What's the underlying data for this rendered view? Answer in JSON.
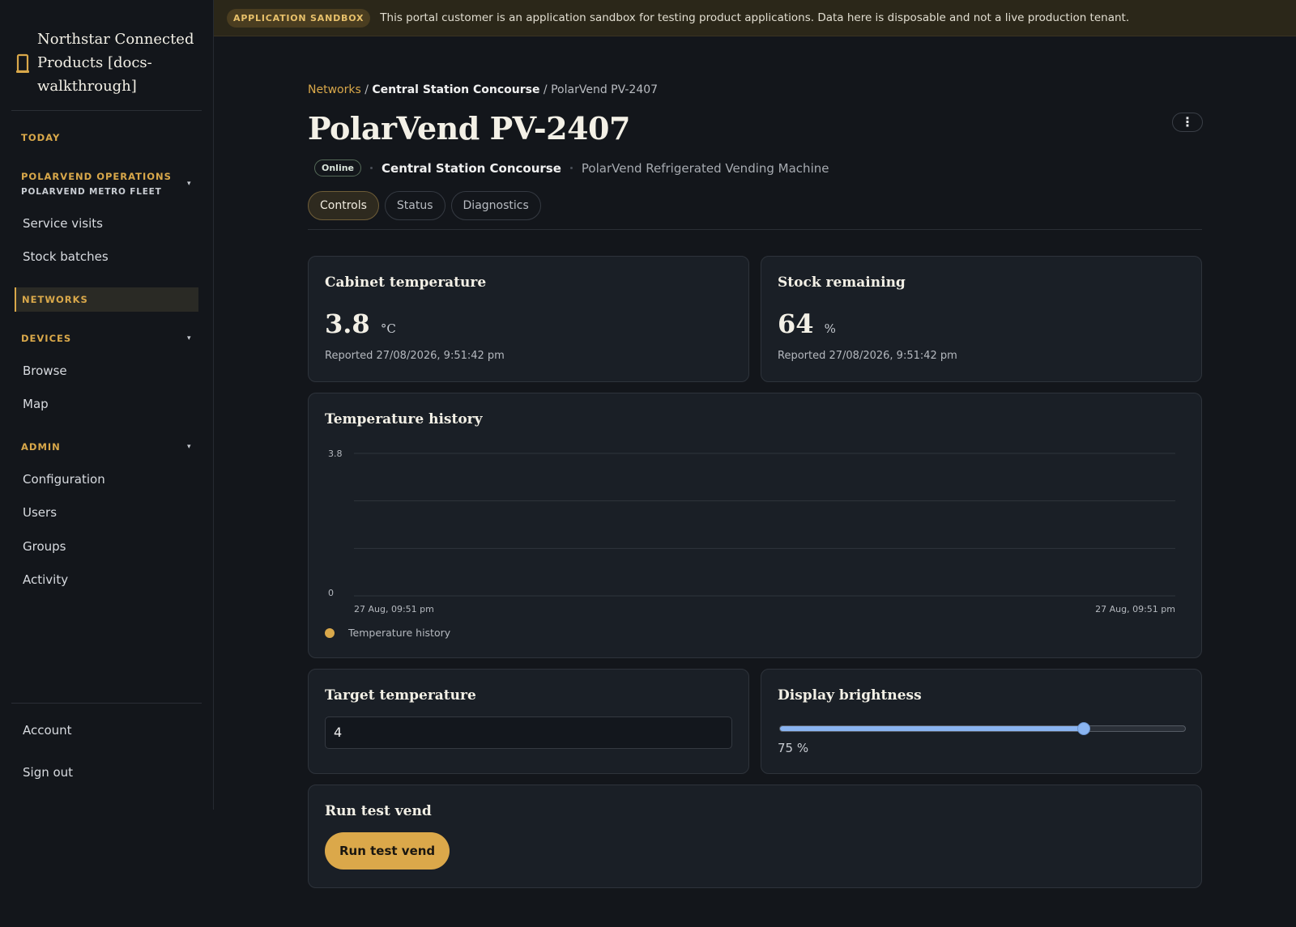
{
  "app": {
    "brand_lines": [
      "Northstar Connected",
      "Products [docs-",
      "walkthrough]"
    ],
    "accent_color": "#d9a84a"
  },
  "banner": {
    "badge": "APPLICATION SANDBOX",
    "text": "This portal customer is an application sandbox for testing product applications. Data here is disposable and not a live production tenant."
  },
  "sidebar": {
    "today": "TODAY",
    "org_title": "POLARVEND OPERATIONS",
    "org_sub": "POLARVEND METRO FLEET",
    "org_items": [
      "Service visits",
      "Stock batches"
    ],
    "networks": "NETWORKS",
    "devices_title": "DEVICES",
    "devices_items": [
      "Browse",
      "Map"
    ],
    "admin_title": "ADMIN",
    "admin_items": [
      "Configuration",
      "Users",
      "Groups",
      "Activity"
    ],
    "footer_items": [
      "Account",
      "Sign out"
    ],
    "caret": "▾"
  },
  "breadcrumb": {
    "networks": "Networks",
    "separator": " / ",
    "location": "Central Station Concourse",
    "device": "PolarVend PV-2407"
  },
  "page": {
    "title": "PolarVend PV-2407",
    "more_icon": "⋮",
    "status": "Online",
    "location": "Central Station Concourse",
    "model": "PolarVend Refrigerated Vending Machine"
  },
  "tabs": [
    {
      "label": "Controls",
      "active": true
    },
    {
      "label": "Status",
      "active": false
    },
    {
      "label": "Diagnostics",
      "active": false
    }
  ],
  "cabinet": {
    "title": "Cabinet temperature",
    "value": "3.8",
    "unit": "°C",
    "reported": "Reported 27/08/2026, 9:51:42 pm"
  },
  "stock": {
    "title": "Stock remaining",
    "value": "64",
    "unit": "%",
    "reported": "Reported 27/08/2026, 9:51:42 pm"
  },
  "chart_data": {
    "type": "line",
    "title": "Temperature history",
    "series": [
      {
        "name": "Temperature history",
        "color": "#d9a84a",
        "values": []
      }
    ],
    "x_tick_labels": [
      "27 Aug, 09:51 pm",
      "27 Aug, 09:51 pm"
    ],
    "y_tick_labels": [
      "3.8",
      "0"
    ],
    "ylim": [
      0,
      3.8
    ],
    "grid": true,
    "legend_position": "bottom-left"
  },
  "target_temp": {
    "title": "Target temperature",
    "value": "4"
  },
  "brightness": {
    "title": "Display brightness",
    "value": 75,
    "label": "75 %",
    "color": "#8ab4f0"
  },
  "test_vend": {
    "title": "Run test vend",
    "button": "Run test vend"
  }
}
